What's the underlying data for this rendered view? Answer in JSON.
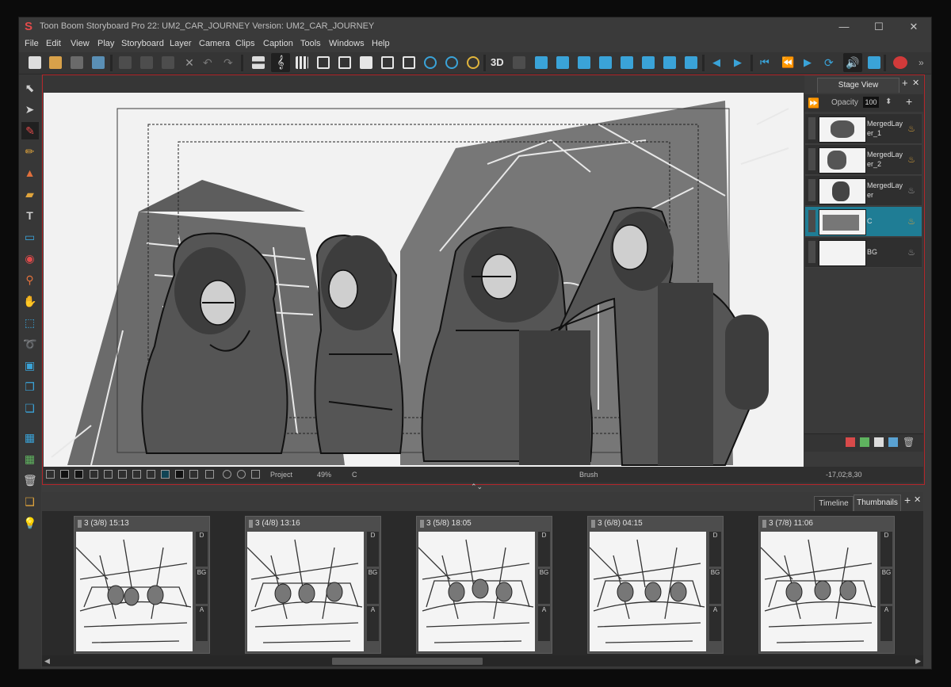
{
  "window": {
    "title": "Toon Boom Storyboard Pro 22: UM2_CAR_JOURNEY Version: UM2_CAR_JOURNEY",
    "app_icon": "S",
    "controls": {
      "minimize": "—",
      "maximize": "☐",
      "close": "✕"
    }
  },
  "menu": [
    "File",
    "Edit",
    "View",
    "Play",
    "Storyboard",
    "Layer",
    "Camera",
    "Clips",
    "Caption",
    "Tools",
    "Windows",
    "Help"
  ],
  "toolbar": {
    "icons": [
      "new-icon",
      "open-icon",
      "save-icon",
      "save-as-icon",
      "cut-icon",
      "copy-icon",
      "paste-icon",
      "delete-icon",
      "undo-icon",
      "redo-icon",
      "ruler-icon",
      "music-icon",
      "grid-icon",
      "layout-icon",
      "layout2-icon",
      "layout3-icon",
      "layout4-icon",
      "frame-icon",
      "zoom-in-icon",
      "zoom-out-icon",
      "clock-icon",
      "3d-icon",
      "3d-off-icon",
      "camera-icon",
      "camera2-icon",
      "camera3-icon",
      "camera4-icon",
      "camera5-icon",
      "camera6-icon",
      "camera7-icon",
      "camera8-icon",
      "prev-icon",
      "play-pause-icon",
      "first-icon",
      "prev-frame-icon",
      "play-icon",
      "loop-icon",
      "sound-icon",
      "share-icon",
      "pot-icon"
    ],
    "label_3d": "3D"
  },
  "tools": [
    "select-icon",
    "transform-icon",
    "brush-icon",
    "pencil-icon",
    "stamp-icon",
    "eraser-icon",
    "text-icon",
    "rectangle-icon",
    "paint-icon",
    "dropper-icon",
    "hand-icon",
    "marquee-icon",
    "lasso-icon",
    "zoom-icon",
    "layer-icon",
    "camera-icon",
    "panel-icon",
    "add-panel-icon",
    "trash-icon",
    "bulb-icon"
  ],
  "stage": {
    "tab": "Stage View",
    "opacity_label": "Opacity",
    "opacity_value": "100",
    "layers": [
      {
        "name": "MergedLayer_1",
        "selected": false,
        "light": "on"
      },
      {
        "name": "MergedLayer_2",
        "selected": false,
        "light": "on"
      },
      {
        "name": "MergedLayer",
        "selected": false,
        "light": "off"
      },
      {
        "name": "C",
        "selected": true,
        "light": "on"
      },
      {
        "name": "BG",
        "selected": false,
        "light": "off"
      }
    ],
    "status": {
      "project": "Project",
      "zoom": "49%",
      "layer": "C",
      "tool": "Brush",
      "coords": "-17,02;8,30"
    }
  },
  "bottom": {
    "tabs": [
      "Timeline",
      "Thumbnails"
    ],
    "active_tab": "Thumbnails",
    "panels": [
      {
        "label": "3 (3/8) 15:13"
      },
      {
        "label": "3 (4/8) 13:16"
      },
      {
        "label": "3 (5/8) 18:05"
      },
      {
        "label": "3 (6/8) 04:15"
      },
      {
        "label": "3 (7/8) 11:06"
      }
    ],
    "layer_tags": [
      "D",
      "BG",
      "A"
    ]
  },
  "colors": {
    "accent_red": "#b3272b",
    "selection_blue": "#1f7d95",
    "play_blue": "#2a9bd8"
  }
}
